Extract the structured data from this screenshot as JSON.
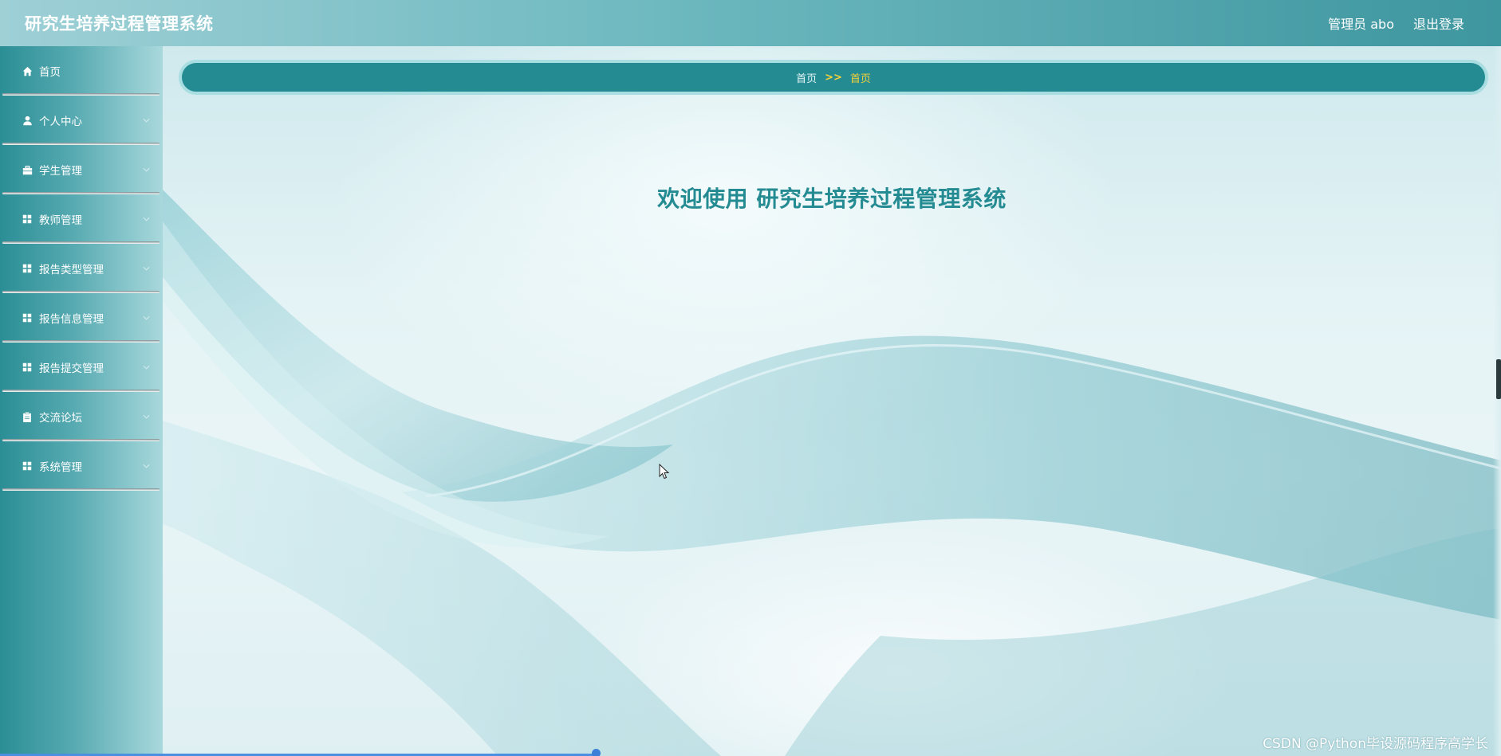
{
  "header": {
    "app_title": "研究生培养过程管理系统",
    "admin_label": "管理员 abo",
    "logout_label": "退出登录"
  },
  "sidebar": {
    "items": [
      {
        "label": "首页",
        "icon": "home-icon",
        "has_submenu": false
      },
      {
        "label": "个人中心",
        "icon": "user-icon",
        "has_submenu": true
      },
      {
        "label": "学生管理",
        "icon": "briefcase-icon",
        "has_submenu": true
      },
      {
        "label": "教师管理",
        "icon": "grid-icon",
        "has_submenu": true
      },
      {
        "label": "报告类型管理",
        "icon": "grid-icon",
        "has_submenu": true
      },
      {
        "label": "报告信息管理",
        "icon": "grid-icon",
        "has_submenu": true
      },
      {
        "label": "报告提交管理",
        "icon": "grid-icon",
        "has_submenu": true
      },
      {
        "label": "交流论坛",
        "icon": "clipboard-icon",
        "has_submenu": true
      },
      {
        "label": "系统管理",
        "icon": "grid-icon",
        "has_submenu": true
      }
    ]
  },
  "breadcrumb": {
    "home": "首页",
    "separator": ">>",
    "current": "首页"
  },
  "main": {
    "welcome_text": "欢迎使用 研究生培养过程管理系统"
  },
  "watermark": "CSDN @Python毕设源码程序高学长",
  "colors": {
    "primary": "#248b92",
    "accent": "#f4d23a",
    "header_gradient_start": "#9ed0d6",
    "header_gradient_end": "#3e969f"
  }
}
